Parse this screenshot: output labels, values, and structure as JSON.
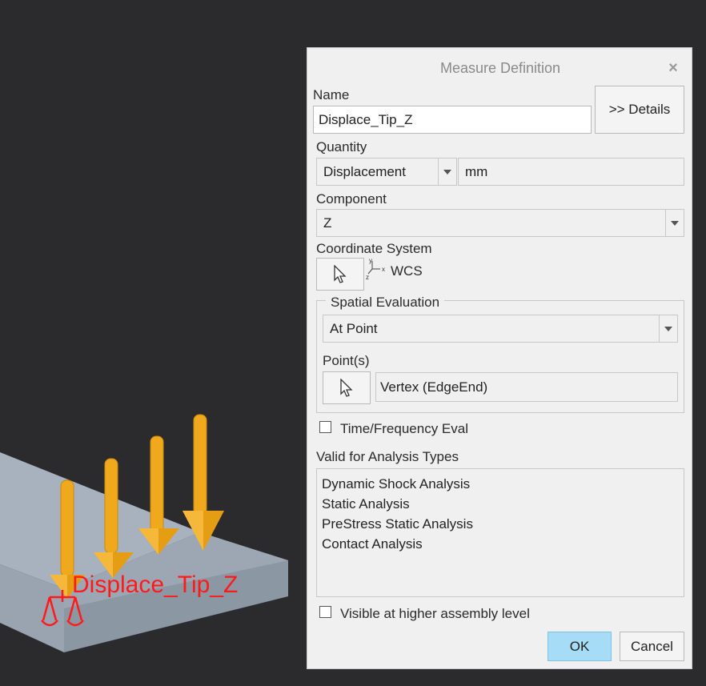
{
  "viewport": {
    "annotation_label": "Displace_Tip_Z"
  },
  "dialog": {
    "title": "Measure Definition",
    "close_glyph": "×",
    "name": {
      "label": "Name",
      "value": "Displace_Tip_Z"
    },
    "details_button": ">> Details",
    "quantity": {
      "label": "Quantity",
      "selected": "Displacement",
      "unit": "mm"
    },
    "component": {
      "label": "Component",
      "selected": "Z"
    },
    "coordinate_system": {
      "label": "Coordinate System",
      "value": "WCS"
    },
    "spatial_evaluation": {
      "group_label": "Spatial Evaluation",
      "selected": "At Point",
      "points_label": "Point(s)",
      "points_value": "Vertex (EdgeEnd)"
    },
    "time_frequency_label": "Time/Frequency Eval",
    "analysis_types": {
      "label": "Valid for Analysis Types",
      "items": [
        "Dynamic Shock Analysis",
        "Static Analysis",
        "PreStress Static Analysis",
        "Contact Analysis"
      ]
    },
    "visible_higher_label": "Visible at higher assembly level",
    "ok_button": "OK",
    "cancel_button": "Cancel"
  },
  "colors": {
    "background": "#2b2b2e",
    "beam": "#a9b3bf",
    "load_arrow": "#f0a81c",
    "annotation": "#ff1a1a",
    "ok_button": "#a6dcf5"
  },
  "icons": {
    "coordinate_selector": "cursor-arrow-icon",
    "point_selector": "cursor-arrow-icon",
    "csys": "coordinate-system-icon"
  }
}
